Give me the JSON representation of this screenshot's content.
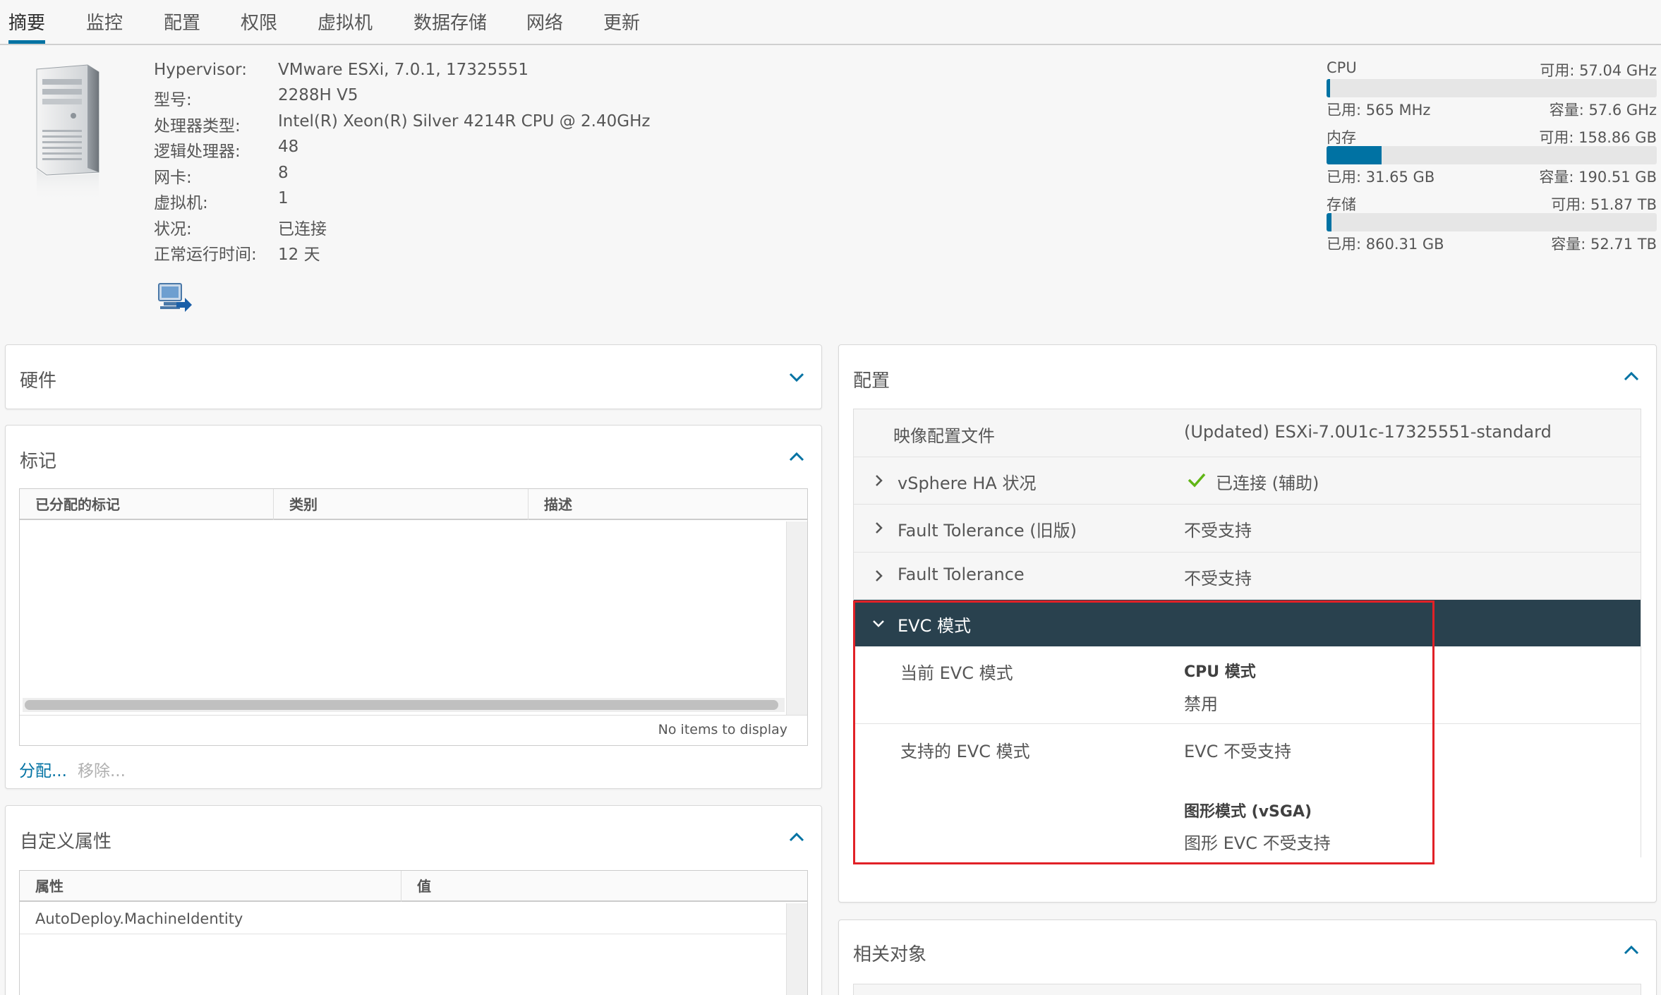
{
  "tabs": [
    "摘要",
    "监控",
    "配置",
    "权限",
    "虚拟机",
    "数据存储",
    "网络",
    "更新"
  ],
  "summary": {
    "rows": [
      {
        "label": "Hypervisor:",
        "value": "VMware ESXi, 7.0.1, 17325551"
      },
      {
        "label": "型号:",
        "value": "2288H V5"
      },
      {
        "label": "处理器类型:",
        "value": "Intel(R) Xeon(R) Silver 4214R CPU @ 2.40GHz"
      },
      {
        "label": "逻辑处理器:",
        "value": "48"
      },
      {
        "label": "网卡:",
        "value": "8"
      },
      {
        "label": "虚拟机:",
        "value": "1"
      },
      {
        "label": "状况:",
        "value": "已连接"
      },
      {
        "label": "正常运行时间:",
        "value": "12 天"
      }
    ]
  },
  "resources": {
    "cpu": {
      "name": "CPU",
      "free": "可用: 57.04 GHz",
      "used": "已用: 565 MHz",
      "capacity": "容量: 57.6 GHz",
      "usage_fraction": 0.01
    },
    "memory": {
      "name": "内存",
      "free": "可用: 158.86 GB",
      "used": "已用: 31.65 GB",
      "capacity": "容量: 190.51 GB",
      "usage_fraction": 0.166
    },
    "storage": {
      "name": "存储",
      "free": "可用: 51.87 TB",
      "used": "已用: 860.31 GB",
      "capacity": "容量: 52.71 TB",
      "usage_fraction": 0.016
    }
  },
  "hardware": {
    "title": "硬件"
  },
  "tags": {
    "title": "标记",
    "columns": [
      "已分配的标记",
      "类别",
      "描述"
    ],
    "empty_text": "No items to display",
    "assign_link": "分配...",
    "remove_link": "移除..."
  },
  "custom_attributes": {
    "title": "自定义属性",
    "columns": [
      "属性",
      "值"
    ],
    "rows": [
      {
        "attribute": "AutoDeploy.MachineIdentity",
        "value": ""
      }
    ]
  },
  "configuration": {
    "title": "配置",
    "image_profile": {
      "label": "映像配置文件",
      "value": "(Updated) ESXi-7.0U1c-17325551-standard"
    },
    "ha_status": {
      "label": "vSphere HA 状况",
      "value": "已连接 (辅助)"
    },
    "ft_legacy": {
      "label": "Fault Tolerance (旧版)",
      "value": "不受支持"
    },
    "ft": {
      "label": "Fault Tolerance",
      "value": "不受支持"
    },
    "evc": {
      "label": "EVC 模式",
      "current_label": "当前 EVC 模式",
      "cpu_mode_title": "CPU 模式",
      "cpu_mode_value": "禁用",
      "supported_label": "支持的 EVC 模式",
      "supported_value": "EVC 不受支持",
      "graphics_title": "图形模式 (vSGA)",
      "graphics_value": "图形 EVC 不受支持"
    }
  },
  "related_objects": {
    "title": "相关对象"
  },
  "colors": {
    "accent": "#0072a3",
    "header_dark": "#29414e",
    "success": "#60b515",
    "highlight": "#e12127"
  }
}
